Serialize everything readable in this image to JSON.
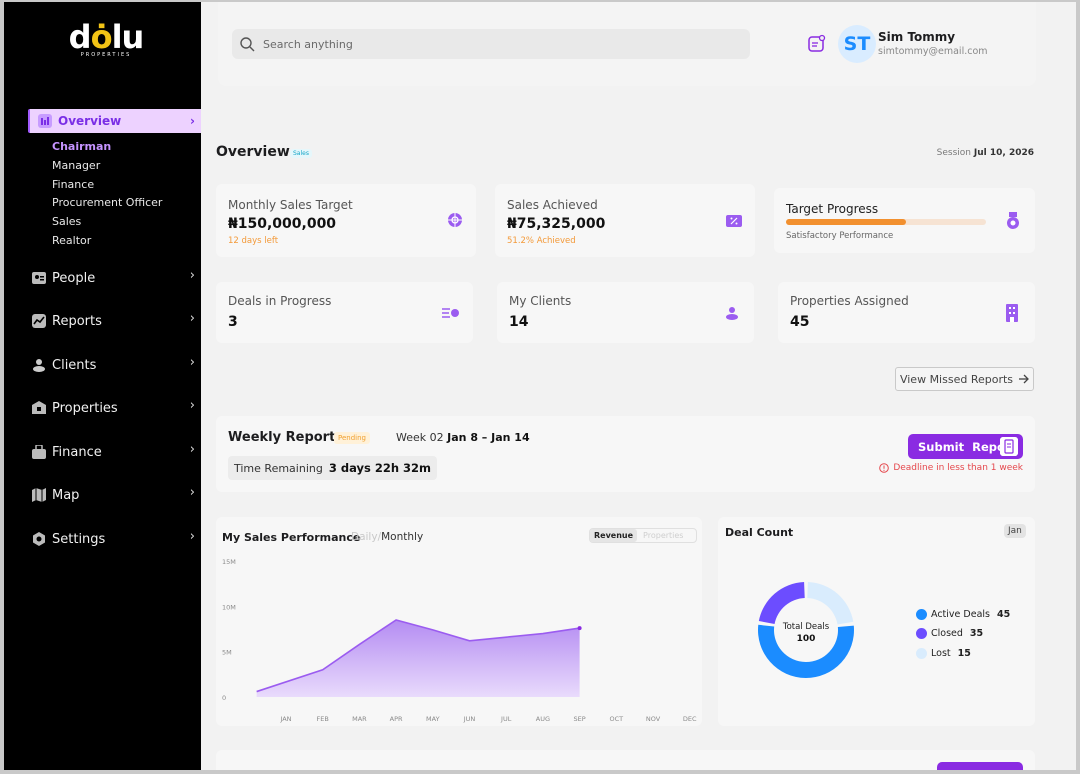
{
  "brand": {
    "name_a": "d",
    "name_dot": "ȯ",
    "name_b": "lu",
    "sub": "PROPERTIES"
  },
  "sidebar": {
    "active": {
      "label": "Overview"
    },
    "subitems": [
      {
        "label": "Chairman",
        "active": true
      },
      {
        "label": "Manager"
      },
      {
        "label": "Finance"
      },
      {
        "label": "Procurement Officer"
      },
      {
        "label": "Sales"
      },
      {
        "label": "Realtor"
      }
    ],
    "items": [
      {
        "label": "People",
        "icon": "people-icon"
      },
      {
        "label": "Reports",
        "icon": "reports-icon"
      },
      {
        "label": "Clients",
        "icon": "clients-icon"
      },
      {
        "label": "Properties",
        "icon": "properties-icon"
      },
      {
        "label": "Finance",
        "icon": "finance-icon"
      },
      {
        "label": "Map",
        "icon": "map-icon"
      },
      {
        "label": "Settings",
        "icon": "settings-icon"
      }
    ]
  },
  "header": {
    "search_placeholder": "Search anything",
    "user": {
      "initials": "ST",
      "name": "Sim Tommy",
      "email": "simtommy@email.com"
    }
  },
  "overview": {
    "title": "Overview",
    "tag": "Sales",
    "session_label": "Session",
    "session_date": "Jul 10, 2026"
  },
  "cards": {
    "monthly_target": {
      "label": "Monthly Sales Target",
      "value": "₦150,000,000",
      "note": "12 days left"
    },
    "sales_achieved": {
      "label": "Sales Achieved",
      "value": "₦75,325,000",
      "note": "51.2% Achieved"
    },
    "target_progress": {
      "label": "Target Progress",
      "note": "Satisfactory Performance",
      "progress": 0.6
    },
    "deals": {
      "label": "Deals in Progress",
      "value": "3"
    },
    "clients": {
      "label": "My Clients",
      "value": "14"
    },
    "properties": {
      "label": "Properties Assigned",
      "value": "45"
    }
  },
  "view_missed": "View Missed Reports",
  "weekly": {
    "title": "Weekly Report",
    "status": "Pending",
    "week_label": "Week 02",
    "week_range": "Jan 8 – Jan 14",
    "remaining_label": "Time Remaining",
    "remaining_value": "3 days 22h 32m",
    "submit_label": "Submit  Report",
    "deadline": "Deadline in less than 1 week"
  },
  "sales_perf": {
    "title": "My Sales Performance",
    "toggle_daily": "Daily",
    "toggle_sep": "/",
    "toggle_monthly": "Monthly",
    "seg_revenue": "Revenue",
    "seg_properties": "Properties"
  },
  "chart_data": {
    "type": "area",
    "x": [
      "JAN",
      "FEB",
      "MAR",
      "APR",
      "MAY",
      "JUN",
      "JUL",
      "AUG",
      "SEP",
      "OCT",
      "NOV",
      "DEC"
    ],
    "y_ticks": [
      "15M",
      "10M",
      "5M",
      "0"
    ],
    "ylim": [
      0,
      15
    ],
    "x_points": [
      -0.8,
      1,
      2,
      3,
      4,
      5,
      6,
      7,
      8,
      9
    ],
    "values": [
      0.6,
      3,
      5.8,
      8.5,
      7.4,
      6.2,
      6.6,
      7,
      7.6
    ]
  },
  "deal_count": {
    "title": "Deal Count",
    "month": "Jan",
    "center_label": "Total Deals",
    "center_value": "100",
    "segments": [
      {
        "label": "Active Deals",
        "value": "45",
        "color": "#1b8cff"
      },
      {
        "label": "Closed",
        "value": "35",
        "color": "#6c4dff"
      },
      {
        "label": "Lost",
        "value": "15",
        "color": "#d9ecfd"
      }
    ]
  },
  "colors": {
    "accent": "#8a2be2",
    "sidebar_bg": "#000000",
    "blue": "#1b8cff",
    "orange": "#f2902f",
    "danger": "#e5484d"
  }
}
